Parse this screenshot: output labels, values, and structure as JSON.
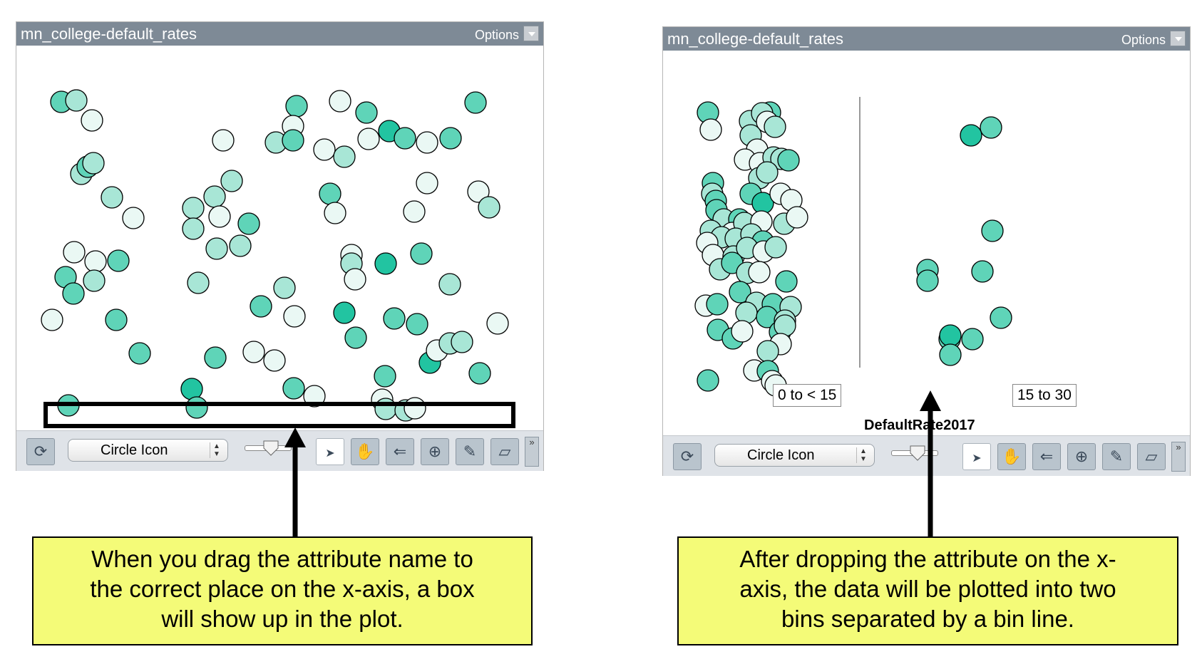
{
  "left_panel": {
    "title": "mn_college-default_rates",
    "options_label": "Options",
    "toolbar": {
      "select_value": "Circle Icon"
    }
  },
  "right_panel": {
    "title": "mn_college-default_rates",
    "options_label": "Options",
    "bins": [
      "0 to < 15",
      "15 to 30"
    ],
    "axis_attribute": "DefaultRate2017",
    "toolbar": {
      "select_value": "Circle Icon"
    }
  },
  "callouts": {
    "left": [
      "When you drag the attribute name to",
      "the correct place on the x-axis, a box",
      "will show up in the plot."
    ],
    "right": [
      "After dropping the attribute on the x-",
      "axis, the data will be plotted into two",
      "bins separated by a bin line."
    ]
  },
  "icons": {
    "refresh": "refresh-icon",
    "select": "arrow-pointer-icon",
    "hand": "hand-icon",
    "move-back": "arrow-left-icon",
    "add-point": "add-point-icon",
    "pen": "pencil-icon",
    "eraser": "eraser-icon",
    "more": "double-chevron-icon"
  },
  "colors": {
    "dot_light": "#eaf8f4",
    "dot_mid": "#a8e6d6",
    "dot_strong": "#5fd4b8",
    "dot_dark": "#22c4a1",
    "callout_bg": "#f4fb78",
    "titlebar": "#7e8a96"
  }
}
